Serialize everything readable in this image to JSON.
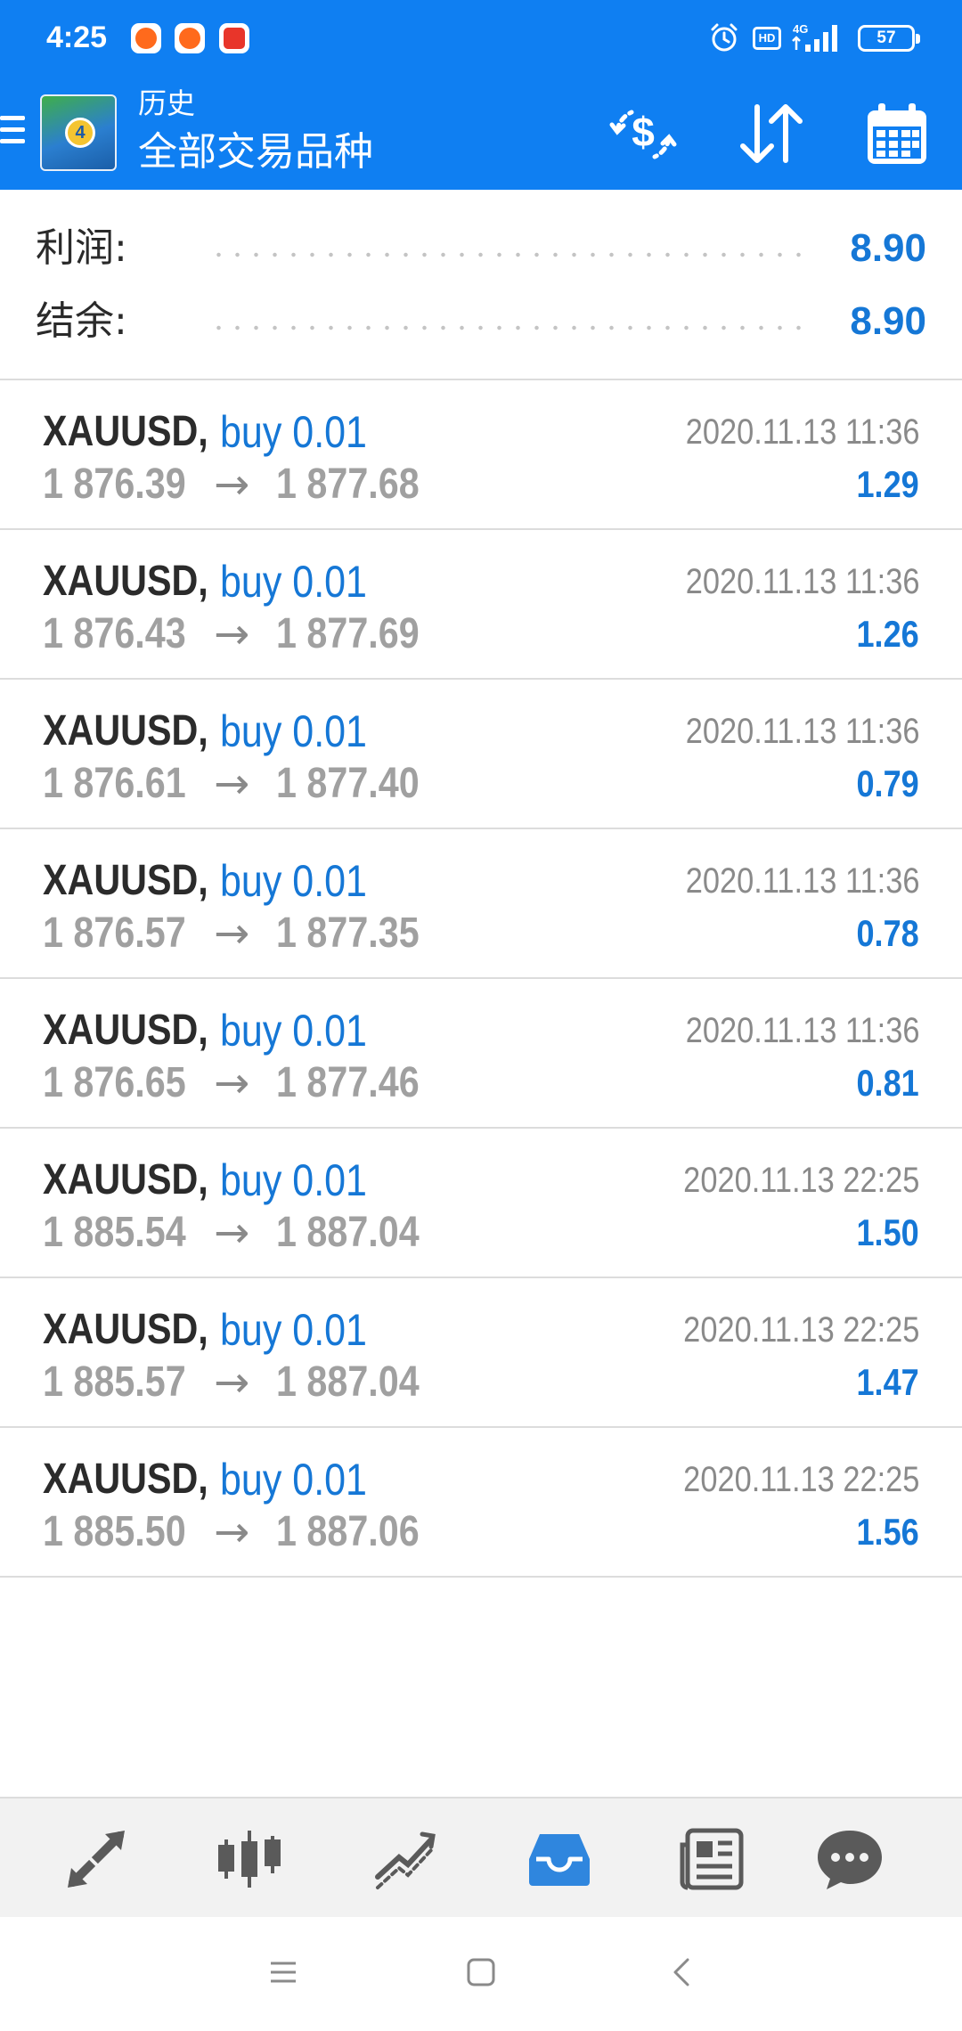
{
  "status_bar": {
    "time": "4:25",
    "network": "4G",
    "hd": "HD",
    "battery": "57"
  },
  "app_bar": {
    "subtitle": "历史",
    "title": "全部交易品种",
    "logo_text": "4"
  },
  "summary": {
    "profit_label": "利润:",
    "profit_value": "8.90",
    "balance_label": "结余:",
    "balance_value": "8.90"
  },
  "trades": [
    {
      "symbol": "XAUUSD,",
      "side": "buy 0.01",
      "open": "1 876.39",
      "arrow": "→",
      "close": "1 877.68",
      "time": "2020.11.13 11:36",
      "profit": "1.29"
    },
    {
      "symbol": "XAUUSD,",
      "side": "buy 0.01",
      "open": "1 876.43",
      "arrow": "→",
      "close": "1 877.69",
      "time": "2020.11.13 11:36",
      "profit": "1.26"
    },
    {
      "symbol": "XAUUSD,",
      "side": "buy 0.01",
      "open": "1 876.61",
      "arrow": "→",
      "close": "1 877.40",
      "time": "2020.11.13 11:36",
      "profit": "0.79"
    },
    {
      "symbol": "XAUUSD,",
      "side": "buy 0.01",
      "open": "1 876.57",
      "arrow": "→",
      "close": "1 877.35",
      "time": "2020.11.13 11:36",
      "profit": "0.78"
    },
    {
      "symbol": "XAUUSD,",
      "side": "buy 0.01",
      "open": "1 876.65",
      "arrow": "→",
      "close": "1 877.46",
      "time": "2020.11.13 11:36",
      "profit": "0.81"
    },
    {
      "symbol": "XAUUSD,",
      "side": "buy 0.01",
      "open": "1 885.54",
      "arrow": "→",
      "close": "1 887.04",
      "time": "2020.11.13 22:25",
      "profit": "1.50"
    },
    {
      "symbol": "XAUUSD,",
      "side": "buy 0.01",
      "open": "1 885.57",
      "arrow": "→",
      "close": "1 887.04",
      "time": "2020.11.13 22:25",
      "profit": "1.47"
    },
    {
      "symbol": "XAUUSD,",
      "side": "buy 0.01",
      "open": "1 885.50",
      "arrow": "→",
      "close": "1 887.06",
      "time": "2020.11.13 22:25",
      "profit": "1.56"
    }
  ],
  "bottom_nav": {
    "items": [
      {
        "icon": "trade-arrows-icon",
        "active": false
      },
      {
        "icon": "candlestick-chart-icon",
        "active": false
      },
      {
        "icon": "trend-lines-icon",
        "active": false
      },
      {
        "icon": "inbox-tray-icon",
        "active": true
      },
      {
        "icon": "news-icon",
        "active": false
      },
      {
        "icon": "chat-bubble-icon",
        "active": false
      }
    ]
  },
  "colors": {
    "header_bg": "#0f7ff2",
    "accent_blue": "#1577d6",
    "nav_active": "#2f86de",
    "nav_inactive": "#5a5a5a",
    "price_gray": "#a0a0a0"
  }
}
